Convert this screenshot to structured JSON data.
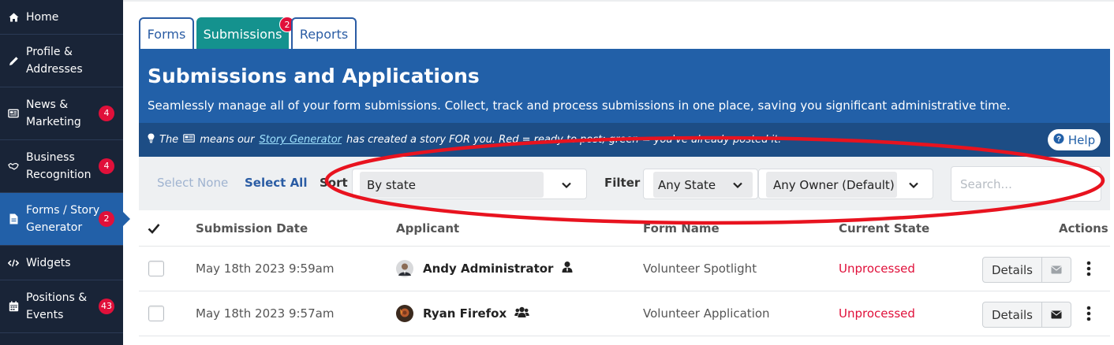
{
  "sidebar": {
    "items": [
      {
        "label": "Home",
        "icon": "home-icon",
        "badge": ""
      },
      {
        "label": "Profile & Addresses",
        "icon": "pencil-icon",
        "badge": ""
      },
      {
        "label": "News & Marketing",
        "icon": "newspaper-icon",
        "badge": "4"
      },
      {
        "label": "Business Recognition",
        "icon": "handshake-icon",
        "badge": "4"
      },
      {
        "label": "Forms / Story Generator",
        "icon": "document-icon",
        "badge": "2",
        "active": true
      },
      {
        "label": "Widgets",
        "icon": "code-icon",
        "badge": ""
      },
      {
        "label": "Positions & Events",
        "icon": "calendar-icon",
        "badge": "43"
      }
    ]
  },
  "tabs": [
    {
      "label": "Forms"
    },
    {
      "label": "Submissions",
      "badge": "2",
      "active": true
    },
    {
      "label": "Reports"
    }
  ],
  "banner": {
    "title": "Submissions and Applications",
    "subtitle": "Seamlessly manage all of your form submissions. Collect, track and process submissions in one place, saving you significant administrative time.",
    "tip_the": "The",
    "tip_means": "means our",
    "tip_link": "Story Generator",
    "tip_rest": "has created a story FOR you. Red = ready to post; green = you've already posted it.",
    "help_label": "Help"
  },
  "toolbar": {
    "select_none": "Select None",
    "select_all": "Select All",
    "sort_label": "Sort",
    "sort_value": "By state",
    "filter_label": "Filter",
    "state_value": "Any State",
    "owner_value": "Any Owner (Default)",
    "search_placeholder": "Search..."
  },
  "table": {
    "columns": [
      "Submission Date",
      "Applicant",
      "Form Name",
      "Current State",
      "Actions"
    ],
    "rows": [
      {
        "date": "May 18th 2023 9:59am",
        "applicant": "Andy Administrator",
        "applicant_icon": "user-tie-icon",
        "form": "Volunteer Spotlight",
        "state": "Unprocessed",
        "action": "Details",
        "mail_icon": "envelope-muted-icon"
      },
      {
        "date": "May 18th 2023 9:57am",
        "applicant": "Ryan Firefox",
        "applicant_icon": "users-icon",
        "form": "Volunteer Application",
        "state": "Unprocessed",
        "action": "Details",
        "mail_icon": "envelope-icon"
      }
    ]
  },
  "colors": {
    "sidebar_bg": "#192437",
    "accent_blue": "#2260a8",
    "tab_active": "#14928e",
    "badge_red": "#e0103a",
    "state_red": "#e0103a",
    "annotation_red": "#e8131f"
  }
}
